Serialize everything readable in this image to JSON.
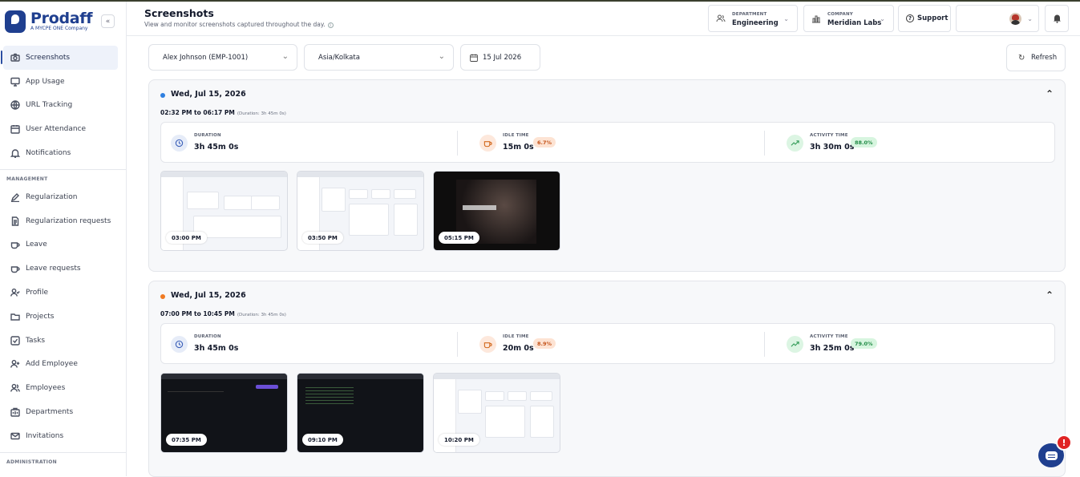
{
  "app": {
    "brand_name": "Prodaff",
    "brand_tagline": "A MYCPE ONE Company",
    "collapse_icon": "chevron-double-left-icon"
  },
  "sidebar": {
    "main_items": [
      {
        "label": "Screenshots",
        "icon": "camera-icon",
        "active": true
      },
      {
        "label": "App Usage",
        "icon": "monitor-icon"
      },
      {
        "label": "URL Tracking",
        "icon": "globe-icon"
      },
      {
        "label": "User Attendance",
        "icon": "calendar-icon"
      },
      {
        "label": "Notifications",
        "icon": "bell-icon"
      }
    ],
    "management_label": "MANAGEMENT",
    "management_items": [
      {
        "label": "Regularization",
        "icon": "pencil-icon"
      },
      {
        "label": "Regularization requests",
        "icon": "document-icon"
      },
      {
        "label": "Leave",
        "icon": "coffee-icon"
      },
      {
        "label": "Leave requests",
        "icon": "coffee-icon"
      },
      {
        "label": "Profile",
        "icon": "user-check-icon"
      },
      {
        "label": "Projects",
        "icon": "folder-icon"
      },
      {
        "label": "Tasks",
        "icon": "checkbox-icon"
      },
      {
        "label": "Add Employee",
        "icon": "user-plus-icon"
      },
      {
        "label": "Employees",
        "icon": "users-icon"
      },
      {
        "label": "Departments",
        "icon": "building-icon"
      },
      {
        "label": "Invitations",
        "icon": "mail-icon"
      }
    ],
    "administration_label": "ADMINISTRATION"
  },
  "header": {
    "title": "Screenshots",
    "subtitle": "View and monitor screenshots captured throughout the day.",
    "department_label": "DEPARTMENT",
    "department_value": "Engineering",
    "company_label": "COMPANY",
    "company_value": "Meridian Labs",
    "support_label": "Support"
  },
  "filters": {
    "employee": "Alex Johnson (EMP-1001)",
    "timezone": "Asia/Kolkata",
    "date": "15 Jul 2026",
    "refresh_label": "Refresh"
  },
  "sessions": [
    {
      "date": "Wed, Jul 15, 2026",
      "dot_color": "#2f7fe0",
      "range": "02:32 PM to 06:17 PM",
      "duration_note": "(Duration: 3h 45m 0s)",
      "duration_label": "DURATION",
      "duration_value": "3h 45m 0s",
      "idle_label": "IDLE TIME",
      "idle_value": "15m 0s",
      "idle_pct": "6.7%",
      "activity_label": "ACTIVITY TIME",
      "activity_value": "3h 30m 0s",
      "activity_pct": "88.0%",
      "screenshots": [
        {
          "time": "03:00 PM",
          "style": "light"
        },
        {
          "time": "03:50 PM",
          "style": "light"
        },
        {
          "time": "05:15 PM",
          "style": "movie"
        }
      ]
    },
    {
      "date": "Wed, Jul 15, 2026",
      "dot_color": "#f07a22",
      "range": "07:00 PM to 10:45 PM",
      "duration_note": "(Duration: 3h 45m 0s)",
      "duration_label": "DURATION",
      "duration_value": "3h 45m 0s",
      "idle_label": "IDLE TIME",
      "idle_value": "20m 0s",
      "idle_pct": "8.9%",
      "activity_label": "ACTIVITY TIME",
      "activity_value": "3h 25m 0s",
      "activity_pct": "79.0%",
      "screenshots": [
        {
          "time": "07:35 PM",
          "style": "dark"
        },
        {
          "time": "09:10 PM",
          "style": "dark"
        },
        {
          "time": "10:20 PM",
          "style": "light"
        }
      ]
    }
  ],
  "colors": {
    "brand": "#1f3f8f",
    "idle_badge_bg": "#fde3d3",
    "idle_badge_fg": "#c4531a",
    "activity_badge_bg": "#d7f5df",
    "activity_badge_fg": "#1f8a44",
    "chat_alert": "#e02424"
  },
  "chat": {
    "alert_glyph": "!"
  }
}
